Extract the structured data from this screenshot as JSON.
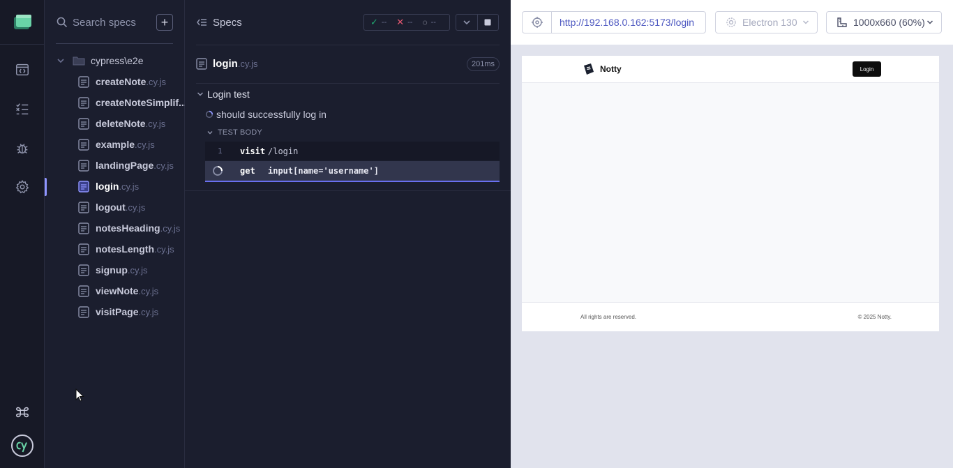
{
  "sidebar": {
    "nav": [
      "specs-nav",
      "runs-nav",
      "debug-nav",
      "settings-nav"
    ],
    "bottom": [
      "keyboard-shortcuts",
      "cypress-logo"
    ]
  },
  "specs_panel": {
    "search_placeholder": "Search specs",
    "add_label": "+",
    "folder": "cypress\\e2e",
    "files": [
      {
        "name": "createNote",
        "ext": ".cy.js"
      },
      {
        "name": "createNoteSimplif...",
        "ext": ""
      },
      {
        "name": "deleteNote",
        "ext": ".cy.js"
      },
      {
        "name": "example",
        "ext": ".cy.js"
      },
      {
        "name": "landingPage",
        "ext": ".cy.js"
      },
      {
        "name": "login",
        "ext": ".cy.js"
      },
      {
        "name": "logout",
        "ext": ".cy.js"
      },
      {
        "name": "notesHeading",
        "ext": ".cy.js"
      },
      {
        "name": "notesLength",
        "ext": ".cy.js"
      },
      {
        "name": "signup",
        "ext": ".cy.js"
      },
      {
        "name": "viewNote",
        "ext": ".cy.js"
      },
      {
        "name": "visitPage",
        "ext": ".cy.js"
      }
    ],
    "active_file": "login"
  },
  "reporter": {
    "title": "Specs",
    "stats": {
      "passed": "--",
      "failed": "--",
      "pending": "--"
    },
    "spec_file": {
      "name": "login",
      "ext": ".cy.js",
      "duration": "201ms"
    },
    "suite": "Login test",
    "test": "should successfully log in",
    "test_body": "TEST BODY",
    "commands": [
      {
        "num": "1",
        "name": "visit",
        "arg": "/login"
      },
      {
        "num": "",
        "name": "get",
        "arg": "input[name='username']"
      }
    ]
  },
  "aut": {
    "url": "http://192.168.0.162:5173/login",
    "browser": "Electron 130",
    "viewport": "1000x660 (60%)",
    "app": {
      "name": "Notty",
      "login_button": "Login",
      "footer_left": "All rights are reserved.",
      "footer_right": "© 2025 Notty."
    }
  },
  "colors": {
    "accent": "#8f95ff",
    "pass": "#1fa971",
    "fail": "#e45770",
    "url": "#4b56c0"
  }
}
